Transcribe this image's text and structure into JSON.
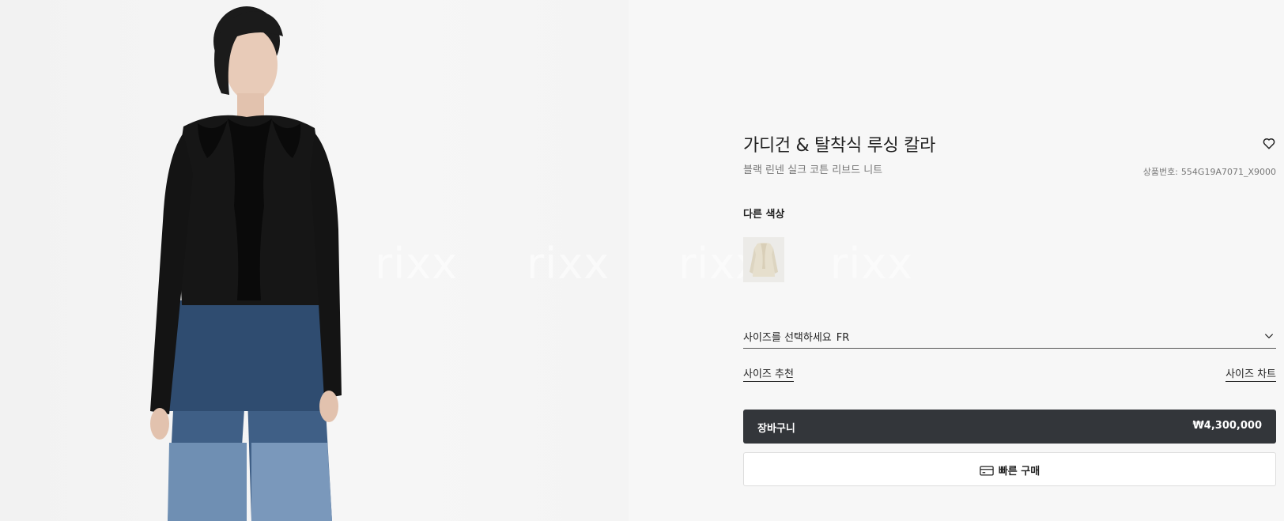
{
  "product": {
    "title": "가디건 & 탈착식 루싱 칼라",
    "subtitle": "블랙 린넨 실크 코튼 리브드 니트",
    "sku_label": "상품번호:",
    "sku_value": "554G19A7071_X9000"
  },
  "colors": {
    "label": "다른 색상",
    "swatches": [
      {
        "name": "ivory",
        "color": "#e9e4d8"
      }
    ]
  },
  "size": {
    "placeholder": "사이즈를 선택하세요",
    "unit": "FR",
    "recommend_label": "사이즈 추천",
    "chart_label": "사이즈 차트"
  },
  "actions": {
    "cart_label": "장바구니",
    "price": "₩4,300,000",
    "quick_buy_label": "빠른 구매"
  },
  "watermark": {
    "text": "rixx"
  },
  "icons": {
    "wishlist": "heart-icon",
    "dropdown": "chevron-down-icon",
    "quick_buy": "credit-card-icon"
  },
  "colors_theme": {
    "cart_bg": "#33363a",
    "page_bg": "#f7f7f7"
  }
}
